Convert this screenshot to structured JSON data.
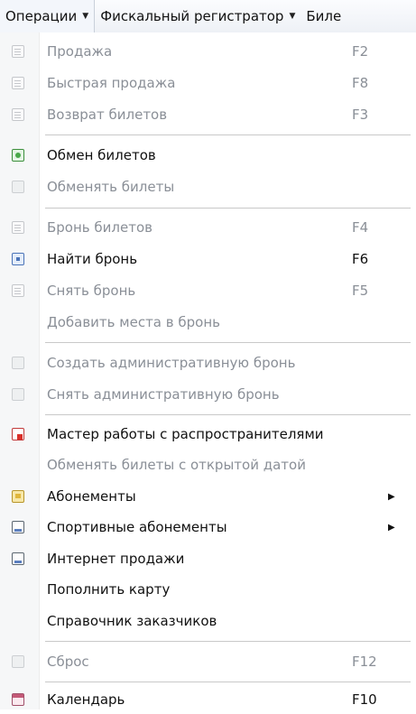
{
  "menubar": {
    "items": [
      {
        "label": "Операции",
        "arrow": "▼"
      },
      {
        "label": "Фискальный регистратор",
        "arrow": "▼"
      },
      {
        "label": "Биле"
      }
    ]
  },
  "menu": {
    "items": [
      {
        "label": "Продажа",
        "shortcut": "F2",
        "icon": "sale-doc-icon"
      },
      {
        "label": "Быстрая продажа",
        "shortcut": "F8",
        "icon": "quick-sale-icon"
      },
      {
        "label": "Возврат билетов",
        "shortcut": "F3",
        "icon": "return-tickets-icon"
      },
      {
        "label": "Обмен билетов",
        "icon": "exchange-icon"
      },
      {
        "label": "Обменять билеты",
        "icon": "exchange-tickets-icon"
      },
      {
        "label": "Бронь билетов",
        "shortcut": "F4",
        "icon": "booking-doc-icon"
      },
      {
        "label": "Найти бронь",
        "shortcut": "F6",
        "icon": "find-booking-icon"
      },
      {
        "label": "Снять бронь",
        "shortcut": "F5",
        "icon": "cancel-booking-icon"
      },
      {
        "label": "Добавить места в бронь"
      },
      {
        "label": "Создать административную бронь",
        "icon": "create-admin-booking-icon"
      },
      {
        "label": "Снять административную бронь",
        "icon": "remove-admin-booking-icon"
      },
      {
        "label": "Мастер работы с распространителями",
        "icon": "distributor-wizard-icon"
      },
      {
        "label": "Обменять билеты с открытой датой"
      },
      {
        "label": "Абонементы",
        "submenu_arrow": "▶",
        "icon": "subscriptions-icon"
      },
      {
        "label": "Спортивные абонементы",
        "submenu_arrow": "▶",
        "icon": "sport-subscriptions-icon"
      },
      {
        "label": "Интернет продажи",
        "icon": "internet-sales-icon"
      },
      {
        "label": "Пополнить карту"
      },
      {
        "label": "Справочник заказчиков"
      },
      {
        "label": "Сброс",
        "shortcut": "F12",
        "icon": "reset-icon"
      },
      {
        "label": "Календарь",
        "shortcut": "F10",
        "icon": "calendar-icon"
      }
    ]
  }
}
